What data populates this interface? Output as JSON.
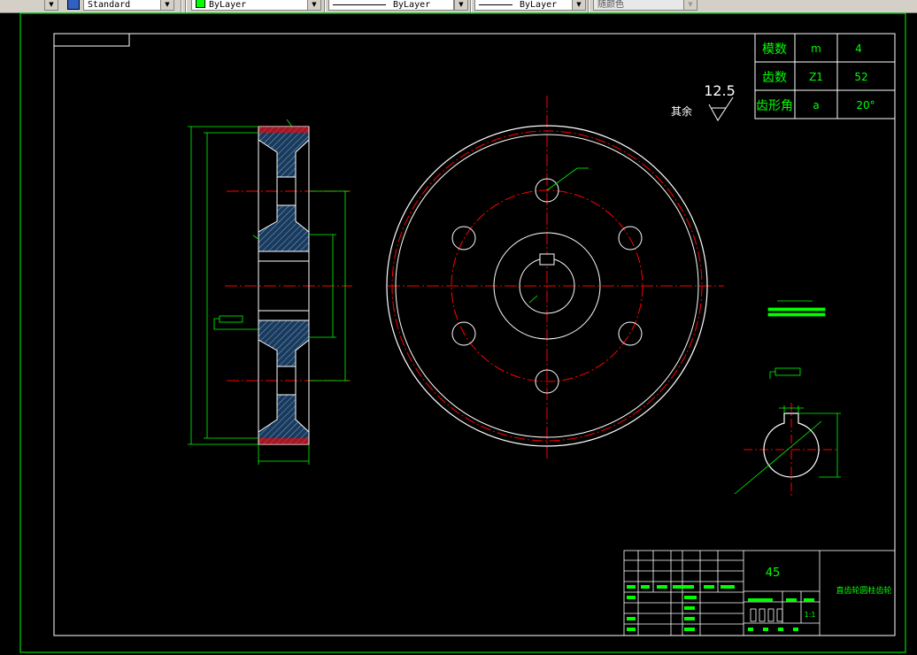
{
  "toolbar": {
    "textstyle": "Standard",
    "layer_color": "ByLayer",
    "linetype": "ByLayer",
    "lineweight": "ByLayer",
    "plotstyle": "随颜色"
  },
  "params": {
    "rows": [
      {
        "label": "模数",
        "symbol": "m",
        "value": "4"
      },
      {
        "label": "齿数",
        "symbol": "Z1",
        "value": "52"
      },
      {
        "label": "齿形角",
        "symbol": "a",
        "value": "20°"
      }
    ]
  },
  "roughness": {
    "value": "12.5",
    "label": "其余"
  },
  "title_block": {
    "material": "45",
    "name": "直齿轮圆柱齿轮",
    "scale": "1:1"
  },
  "colors": {
    "background": "#000000",
    "lines": "#ffffff",
    "dims": "#00ff00",
    "centerlines": "#ff0000",
    "hatch_bg": "#1a3a5c",
    "hatch": "#7fa8d0"
  }
}
